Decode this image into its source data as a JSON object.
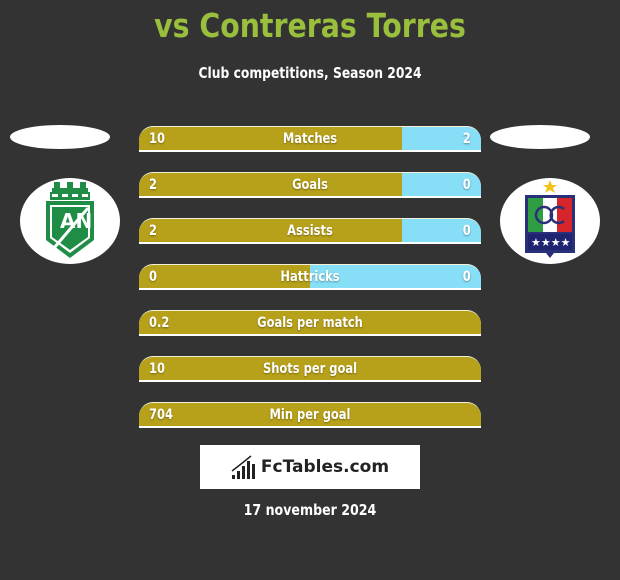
{
  "header": {
    "title": "vs Contreras Torres",
    "subtitle": "Club competitions, Season 2024"
  },
  "teams": {
    "left": {
      "logo_icon": "atletico-nacional-crest-icon",
      "logo_text": "AN"
    },
    "right": {
      "logo_icon": "once-caldas-crest-icon",
      "logo_text": "OC"
    }
  },
  "colors": {
    "title": "#99bf3c",
    "left_bar": "#b8a11a",
    "right_bar": "#87def7",
    "background": "#333333"
  },
  "stats": [
    {
      "label": "Matches",
      "left": "10",
      "right": "2",
      "left_share": 0.77
    },
    {
      "label": "Goals",
      "left": "2",
      "right": "0",
      "left_share": 0.77
    },
    {
      "label": "Assists",
      "left": "2",
      "right": "0",
      "left_share": 0.77
    },
    {
      "label": "Hattricks",
      "left": "0",
      "right": "0",
      "left_share": 0.5
    },
    {
      "label": "Goals per match",
      "left": "0.2",
      "right": "",
      "left_share": 1.0
    },
    {
      "label": "Shots per goal",
      "left": "10",
      "right": "",
      "left_share": 1.0
    },
    {
      "label": "Min per goal",
      "left": "704",
      "right": "",
      "left_share": 1.0
    }
  ],
  "brand": {
    "text": "FcTables.com",
    "icon": "bar-chart-icon"
  },
  "footer": {
    "date": "17 november 2024"
  }
}
